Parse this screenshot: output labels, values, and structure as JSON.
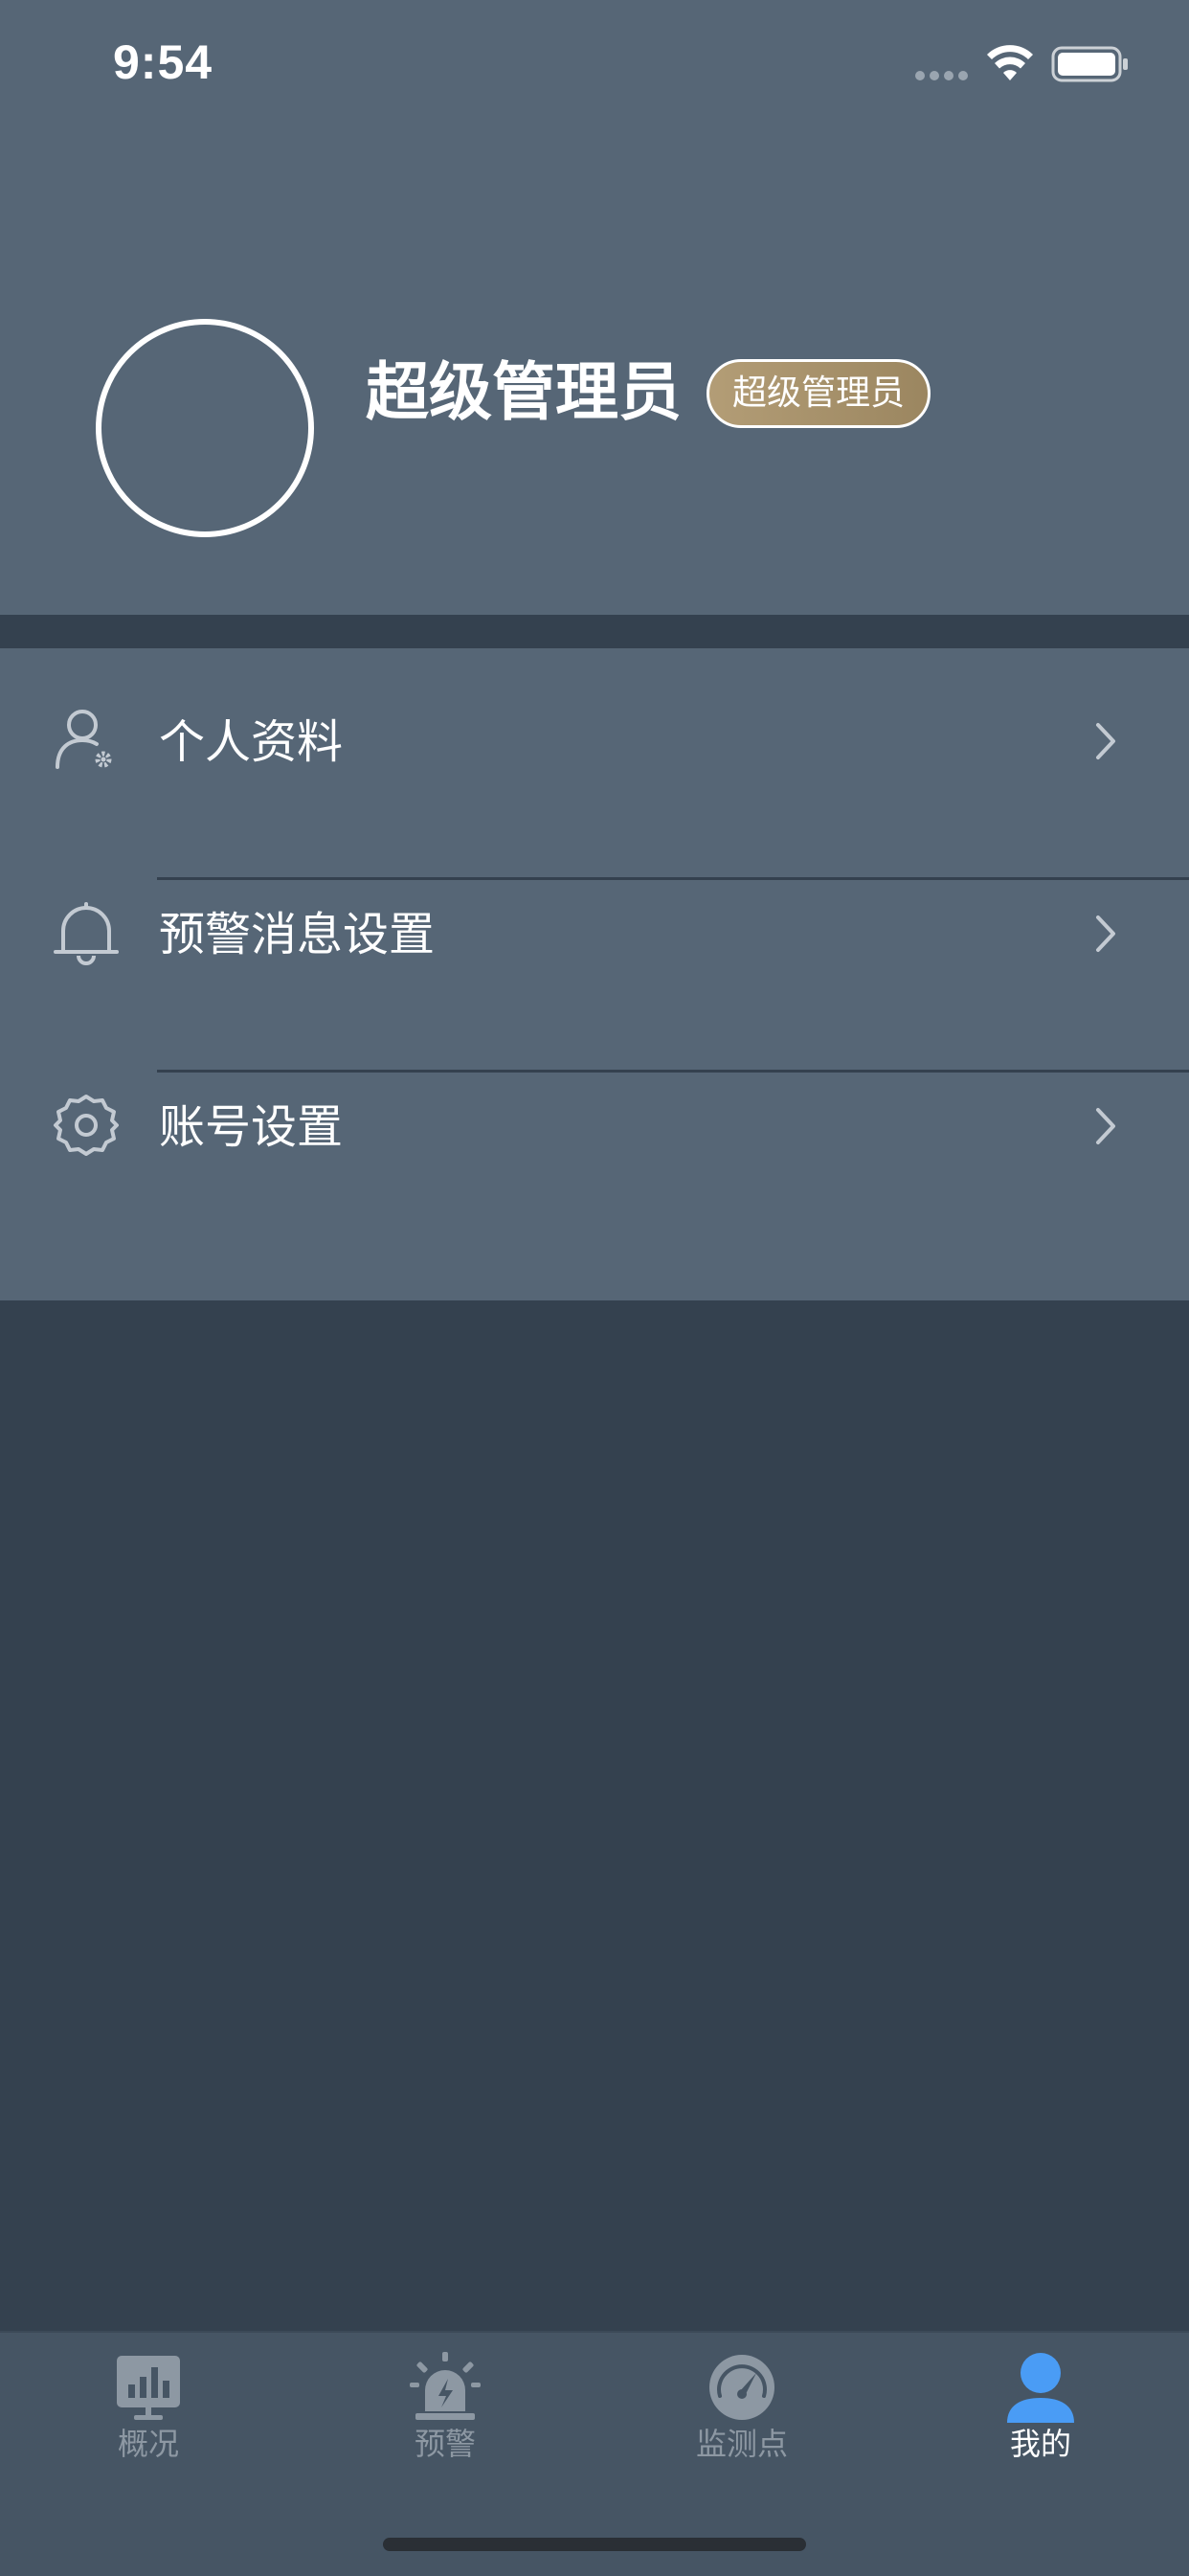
{
  "status_bar": {
    "time": "9:54",
    "wifi_icon": "wifi-icon",
    "battery_icon": "battery-icon"
  },
  "profile": {
    "name": "超级管理员",
    "role_badge": "超级管理员",
    "badge_color": "#a8936c"
  },
  "menu": {
    "items": [
      {
        "label": "个人资料",
        "icon": "user-settings-icon"
      },
      {
        "label": "预警消息设置",
        "icon": "bell-icon"
      },
      {
        "label": "账号设置",
        "icon": "gear-icon"
      }
    ]
  },
  "tabbar": {
    "active_index": 3,
    "active_color": "#4a9cf5",
    "tabs": [
      {
        "label": "概况",
        "icon": "chart-monitor-icon"
      },
      {
        "label": "预警",
        "icon": "alarm-light-icon"
      },
      {
        "label": "监测点",
        "icon": "gauge-icon"
      },
      {
        "label": "我的",
        "icon": "person-icon"
      }
    ]
  }
}
